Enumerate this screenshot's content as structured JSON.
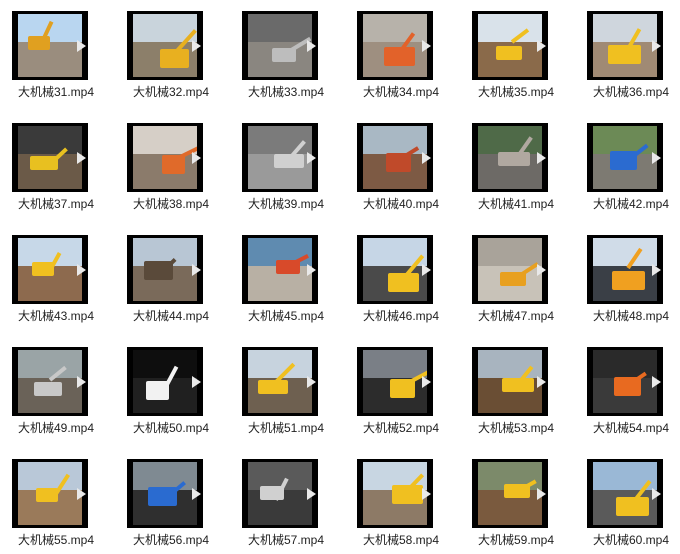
{
  "files": [
    {
      "name": "大机械31.mp4",
      "sky": "#b9d6f0",
      "ground": "#9a8d7e",
      "accent": "#e0a020",
      "icon": "video-file-icon"
    },
    {
      "name": "大机械32.mp4",
      "sky": "#c9d4dc",
      "ground": "#8c7f6a",
      "accent": "#e8b020",
      "icon": "video-file-icon"
    },
    {
      "name": "大机械33.mp4",
      "sky": "#6a6a6a",
      "ground": "#8a8680",
      "accent": "#bdbdbd",
      "icon": "video-file-icon"
    },
    {
      "name": "大机械34.mp4",
      "sky": "#b7b2aa",
      "ground": "#9e8f80",
      "accent": "#e2622a",
      "icon": "video-file-icon"
    },
    {
      "name": "大机械35.mp4",
      "sky": "#d9e2ea",
      "ground": "#8a6a4a",
      "accent": "#f0c020",
      "icon": "video-file-icon"
    },
    {
      "name": "大机械36.mp4",
      "sky": "#cfd6dd",
      "ground": "#a08a74",
      "accent": "#f0c020",
      "icon": "video-file-icon"
    },
    {
      "name": "大机械37.mp4",
      "sky": "#3a3a3a",
      "ground": "#6b5a48",
      "accent": "#e8c020",
      "icon": "video-file-icon"
    },
    {
      "name": "大机械38.mp4",
      "sky": "#d6cfc7",
      "ground": "#8b7b6b",
      "accent": "#e06a2a",
      "icon": "video-file-icon"
    },
    {
      "name": "大机械39.mp4",
      "sky": "#7b7b7b",
      "ground": "#9a9a9a",
      "accent": "#d0d0d0",
      "icon": "video-file-icon"
    },
    {
      "name": "大机械40.mp4",
      "sky": "#a9b8c4",
      "ground": "#7d5a44",
      "accent": "#c04a2a",
      "icon": "video-file-icon"
    },
    {
      "name": "大机械41.mp4",
      "sky": "#4f6a48",
      "ground": "#6d6a66",
      "accent": "#b0a8a0",
      "icon": "video-file-icon"
    },
    {
      "name": "大机械42.mp4",
      "sky": "#6c8a56",
      "ground": "#7d7a72",
      "accent": "#2b6bd0",
      "icon": "video-file-icon"
    },
    {
      "name": "大机械43.mp4",
      "sky": "#c7d8e8",
      "ground": "#8d6a4e",
      "accent": "#f0c020",
      "icon": "video-file-icon"
    },
    {
      "name": "大机械44.mp4",
      "sky": "#b8c6d4",
      "ground": "#7a6a5a",
      "accent": "#5a4a3a",
      "icon": "video-file-icon"
    },
    {
      "name": "大机械45.mp4",
      "sky": "#5f8bb0",
      "ground": "#b8b0a4",
      "accent": "#d84a2a",
      "icon": "video-file-icon"
    },
    {
      "name": "大机械46.mp4",
      "sky": "#c6d6e6",
      "ground": "#4a4a4a",
      "accent": "#f0c020",
      "icon": "video-file-icon"
    },
    {
      "name": "大机械47.mp4",
      "sky": "#a9a39a",
      "ground": "#c8c2b8",
      "accent": "#e8a020",
      "icon": "video-file-icon"
    },
    {
      "name": "大机械48.mp4",
      "sky": "#d0dce8",
      "ground": "#3a3f46",
      "accent": "#f0a020",
      "icon": "video-file-icon"
    },
    {
      "name": "大机械49.mp4",
      "sky": "#9aa4a6",
      "ground": "#6a6258",
      "accent": "#c8c8c8",
      "icon": "video-file-icon"
    },
    {
      "name": "大机械50.mp4",
      "sky": "#0e0e0e",
      "ground": "#202020",
      "accent": "#f2f2f2",
      "icon": "video-file-icon"
    },
    {
      "name": "大机械51.mp4",
      "sky": "#c7d3de",
      "ground": "#6e6050",
      "accent": "#f0c020",
      "icon": "video-file-icon"
    },
    {
      "name": "大机械52.mp4",
      "sky": "#7a7f86",
      "ground": "#2c2c2c",
      "accent": "#f0c020",
      "icon": "video-file-icon"
    },
    {
      "name": "大机械53.mp4",
      "sky": "#a8b4bf",
      "ground": "#6a4e34",
      "accent": "#f0c020",
      "icon": "video-file-icon"
    },
    {
      "name": "大机械54.mp4",
      "sky": "#2a2a2a",
      "ground": "#3a3a3a",
      "accent": "#e86a20",
      "icon": "video-file-icon"
    },
    {
      "name": "大机械55.mp4",
      "sky": "#b9c8d8",
      "ground": "#9a7a5a",
      "accent": "#f0c020",
      "icon": "video-file-icon"
    },
    {
      "name": "大机械56.mp4",
      "sky": "#7f8a92",
      "ground": "#2f2f2f",
      "accent": "#2a6bd0",
      "icon": "video-file-icon"
    },
    {
      "name": "大机械57.mp4",
      "sky": "#5a5a5a",
      "ground": "#3a3a3a",
      "accent": "#d0d0d0",
      "icon": "video-file-icon"
    },
    {
      "name": "大机械58.mp4",
      "sky": "#c8d6e2",
      "ground": "#8d7a66",
      "accent": "#f0c020",
      "icon": "video-file-icon"
    },
    {
      "name": "大机械59.mp4",
      "sky": "#7c8a6a",
      "ground": "#7a5a3e",
      "accent": "#f0c020",
      "icon": "video-file-icon"
    },
    {
      "name": "大机械60.mp4",
      "sky": "#9ab8d6",
      "ground": "#5a5a5a",
      "accent": "#f0c020",
      "icon": "video-file-icon"
    }
  ]
}
